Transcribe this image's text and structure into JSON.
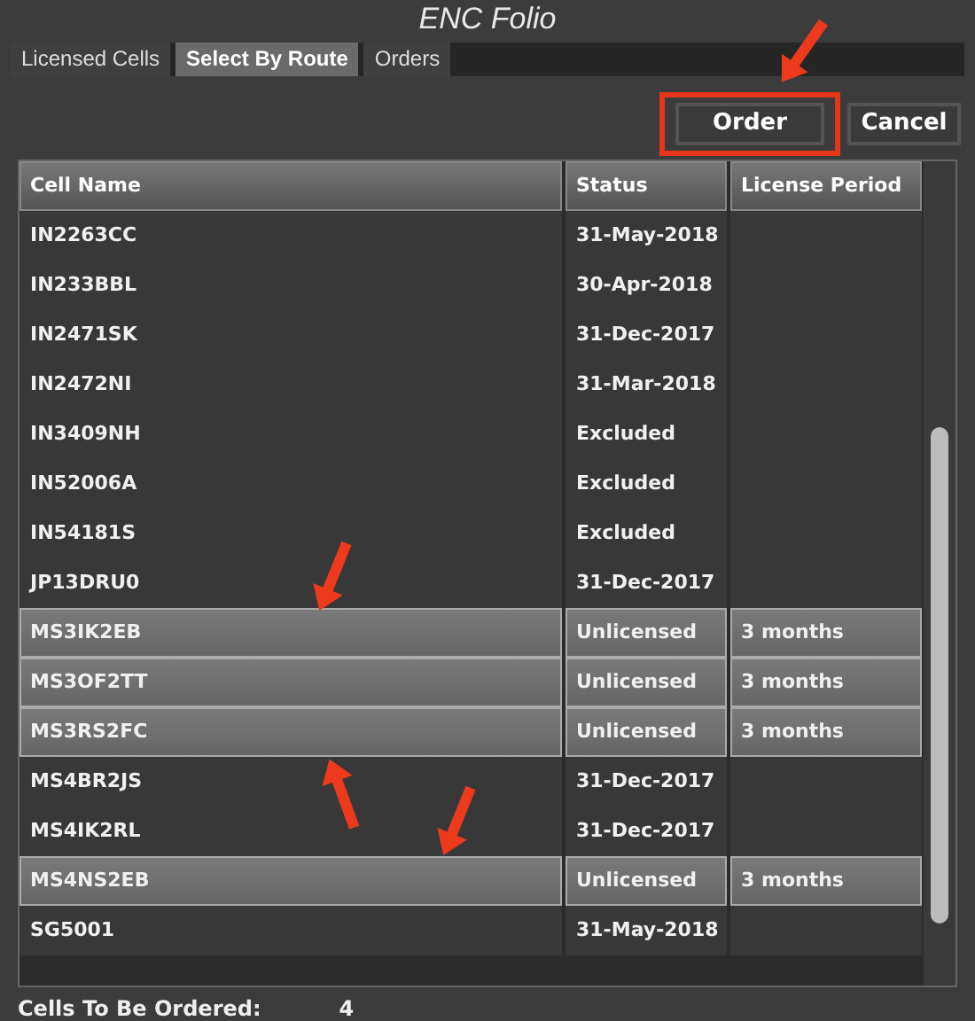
{
  "window": {
    "title": "ENC Folio"
  },
  "tabs": [
    {
      "label": "Licensed Cells",
      "selected": false
    },
    {
      "label": "Select By Route",
      "selected": true
    },
    {
      "label": "Orders",
      "selected": false
    }
  ],
  "buttons": [
    {
      "label": "Order",
      "highlighted": true
    },
    {
      "label": "Cancel",
      "highlighted": false
    }
  ],
  "table": {
    "columns": [
      "Cell Name",
      "Status",
      "License Period"
    ],
    "rows": [
      {
        "cells": [
          "IN2263CC",
          "31-May-2018",
          ""
        ],
        "selected": false
      },
      {
        "cells": [
          "IN233BBL",
          "30-Apr-2018",
          ""
        ],
        "selected": false
      },
      {
        "cells": [
          "IN2471SK",
          "31-Dec-2017",
          ""
        ],
        "selected": false
      },
      {
        "cells": [
          "IN2472NI",
          "31-Mar-2018",
          ""
        ],
        "selected": false
      },
      {
        "cells": [
          "IN3409NH",
          "Excluded",
          ""
        ],
        "selected": false
      },
      {
        "cells": [
          "IN52006A",
          "Excluded",
          ""
        ],
        "selected": false
      },
      {
        "cells": [
          "IN54181S",
          "Excluded",
          ""
        ],
        "selected": false
      },
      {
        "cells": [
          "JP13DRU0",
          "31-Dec-2017",
          ""
        ],
        "selected": false
      },
      {
        "cells": [
          "MS3IK2EB",
          "Unlicensed",
          "3 months"
        ],
        "selected": true
      },
      {
        "cells": [
          "MS3OF2TT",
          "Unlicensed",
          "3 months"
        ],
        "selected": true
      },
      {
        "cells": [
          "MS3RS2FC",
          "Unlicensed",
          "3 months"
        ],
        "selected": true
      },
      {
        "cells": [
          "MS4BR2JS",
          "31-Dec-2017",
          ""
        ],
        "selected": false
      },
      {
        "cells": [
          "MS4IK2RL",
          "31-Dec-2017",
          ""
        ],
        "selected": false
      },
      {
        "cells": [
          "MS4NS2EB",
          "Unlicensed",
          "3 months"
        ],
        "selected": true
      },
      {
        "cells": [
          "SG5001",
          "31-May-2018",
          ""
        ],
        "selected": false
      }
    ]
  },
  "footer": {
    "label": "Cells To Be Ordered:",
    "value": "4"
  }
}
